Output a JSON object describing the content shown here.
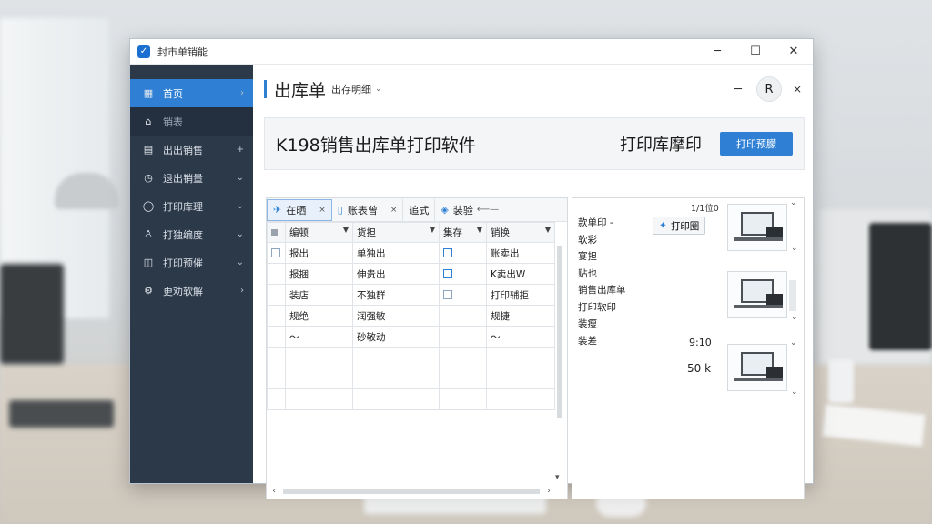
{
  "window": {
    "title": "封市单销能",
    "controls": {
      "minimize": "─",
      "maximize": "☐",
      "close": "✕"
    }
  },
  "sidebar": {
    "items": [
      {
        "icon": "grid-icon",
        "glyph": "▦",
        "label": "首页",
        "arrow": "›",
        "active": true
      },
      {
        "icon": "home-icon",
        "glyph": "⌂",
        "label": "销表",
        "arrow": "",
        "sub": true
      },
      {
        "icon": "document-icon",
        "glyph": "▤",
        "label": "出出销售",
        "arrow": "+"
      },
      {
        "icon": "clock-icon",
        "glyph": "◷",
        "label": "退出销量",
        "arrow": "⌄"
      },
      {
        "icon": "circle-icon",
        "glyph": "◯",
        "label": "打印库理",
        "arrow": "⌄"
      },
      {
        "icon": "user-icon",
        "glyph": "♙",
        "label": "打独编度",
        "arrow": "⌄"
      },
      {
        "icon": "layout-icon",
        "glyph": "◫",
        "label": "打印预催",
        "arrow": "⌄"
      },
      {
        "icon": "gear-icon",
        "glyph": "⚙",
        "label": "更劝软解",
        "arrow": "›"
      }
    ]
  },
  "header": {
    "title": "出库单",
    "subtitle": "出存明细",
    "dropdown_glyph": "⌄",
    "minimize": "─",
    "avatar_letter": "R",
    "close": "×"
  },
  "banner": {
    "title": "K198销售出库单打印软件",
    "caption": "打印库摩印",
    "button": "打印预朦"
  },
  "table": {
    "tabs": [
      {
        "icon": "pin-icon",
        "glyph": "✈",
        "label": "在晒",
        "close": "×",
        "active": true
      },
      {
        "icon": "file-icon",
        "glyph": "▯",
        "label": "账表曾",
        "close": "×"
      },
      {
        "label": "追式"
      },
      {
        "icon": "tag-icon",
        "glyph": "◈",
        "label": "装验",
        "dash": "⟵—"
      }
    ],
    "columns": [
      "编顿",
      "货担",
      "集存",
      "销换"
    ],
    "rows": [
      [
        "报出",
        "单独出",
        "",
        "账卖出"
      ],
      [
        "报捆",
        "伸贵出",
        "",
        "K卖出W"
      ],
      [
        "装店",
        "不独群",
        "",
        "打印辅拒"
      ],
      [
        "规绝",
        "润强敏",
        "",
        "规捷"
      ],
      [
        "～",
        "砂敬动",
        "",
        "～"
      ],
      [
        "",
        "",
        "",
        ""
      ],
      [
        "",
        "",
        "",
        ""
      ],
      [
        "",
        "",
        "",
        ""
      ]
    ]
  },
  "side_panel": {
    "count_top": "1/1位0",
    "labels": [
      "款单印 -",
      "软彩",
      "宴担",
      "贴也",
      "销售出库单",
      "打印软印",
      "装瘦",
      "装差"
    ],
    "print_button": "打印圈",
    "weight1": "9:10",
    "weight2": "50 k"
  },
  "colors": {
    "sidebar_bg": "#2c3949",
    "accent": "#2f80d4",
    "window_border": "#b9c3cc"
  }
}
